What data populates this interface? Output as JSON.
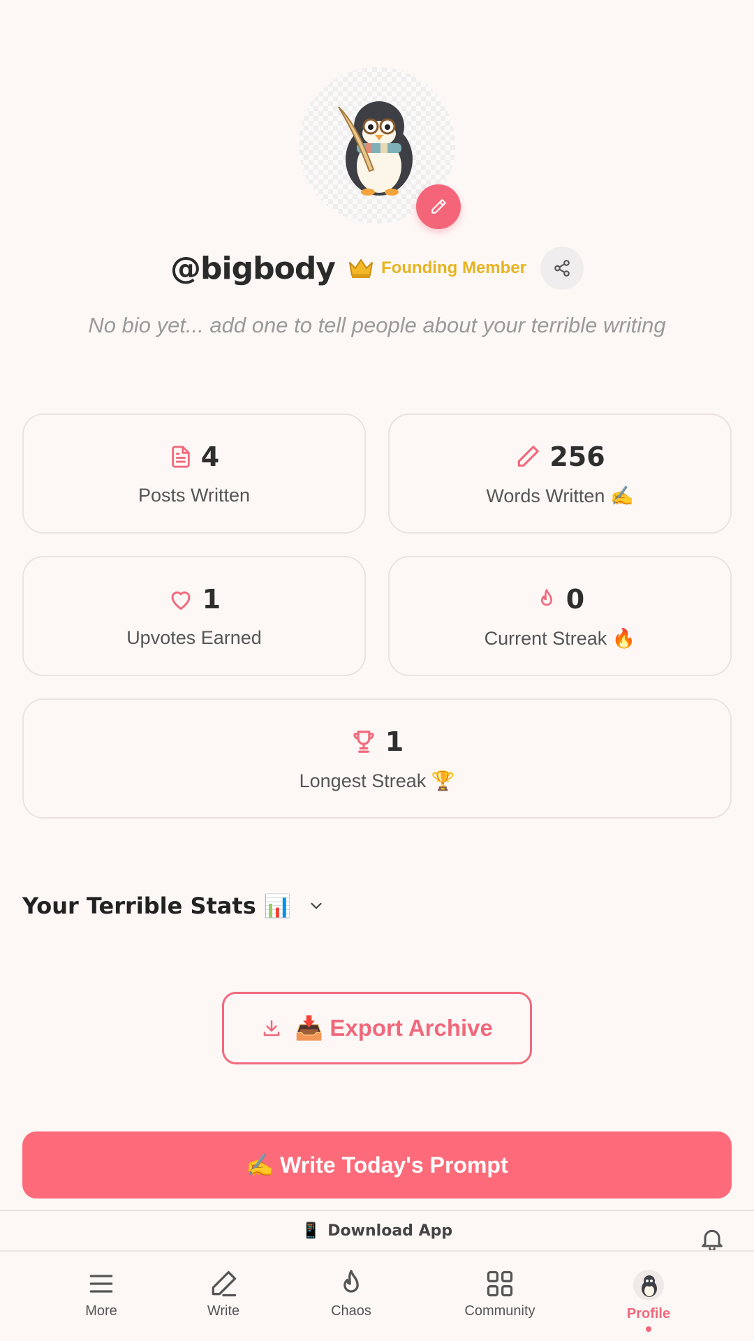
{
  "profile": {
    "username": "@bigbody",
    "badge_label": "Founding Member",
    "bio": "No bio yet... add one to tell people about your terrible writing"
  },
  "stats": {
    "posts": {
      "value": "4",
      "label": "Posts Written"
    },
    "words": {
      "value": "256",
      "label": "Words Written ✍️"
    },
    "upvotes": {
      "value": "1",
      "label": "Upvotes Earned"
    },
    "current_streak": {
      "value": "0",
      "label": "Current Streak 🔥"
    },
    "longest_streak": {
      "value": "1",
      "label": "Longest Streak 🏆"
    }
  },
  "stats_section": {
    "title": "Your Terrible Stats 📊"
  },
  "actions": {
    "export_label": "📥 Export Archive",
    "write_label": "✍️ Write Today's Prompt"
  },
  "download": {
    "label": "Download App",
    "icon": "📱"
  },
  "nav": {
    "items": [
      {
        "label": "More"
      },
      {
        "label": "Write"
      },
      {
        "label": "Chaos"
      },
      {
        "label": "Community"
      },
      {
        "label": "Profile"
      }
    ]
  },
  "colors": {
    "accent": "#fd6b7a",
    "badge": "#e6b422",
    "background": "#fdf8f6"
  }
}
